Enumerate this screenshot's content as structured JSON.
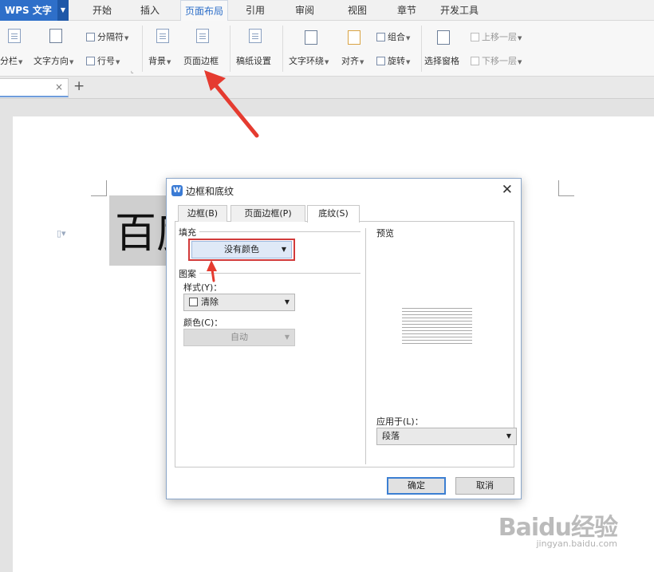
{
  "app": {
    "name": "WPS 文字"
  },
  "menu": {
    "tabs": [
      "开始",
      "插入",
      "页面布局",
      "引用",
      "审阅",
      "视图",
      "章节",
      "开发工具"
    ],
    "active": "页面布局"
  },
  "ribbon": {
    "fenlan": "分栏",
    "text_direction": "文字方向",
    "separator": "分隔符",
    "line_number": "行号",
    "background": "背景",
    "page_border": "页面边框",
    "draft_settings": "稿纸设置",
    "text_wrap": "文字环绕",
    "align": "对齐",
    "group": "组合",
    "rotate": "旋转",
    "selection_pane": "选择窗格",
    "bring_forward": "上移一层",
    "send_backward": "下移一层"
  },
  "doc_tab": {
    "close": "×",
    "new": "+"
  },
  "document": {
    "text": "百度"
  },
  "dialog": {
    "title": "边框和底纹",
    "close": "✕",
    "tabs": [
      "边框(B)",
      "页面边框(P)",
      "底纹(S)"
    ],
    "active_tab": "底纹(S)",
    "fill_label": "填充",
    "fill_value": "没有颜色",
    "pattern_label": "图案",
    "style_label": "样式(Y)：",
    "style_value": "清除",
    "color_label": "颜色(C)：",
    "color_value": "自动",
    "preview_label": "预览",
    "apply_label": "应用于(L)：",
    "apply_value": "段落",
    "ok": "确定",
    "cancel": "取消"
  },
  "watermark": {
    "brand": "Baidu经验",
    "url": "jingyan.baidu.com"
  },
  "colors": {
    "accent": "#2e6fc9",
    "highlight": "#d23a3a"
  }
}
